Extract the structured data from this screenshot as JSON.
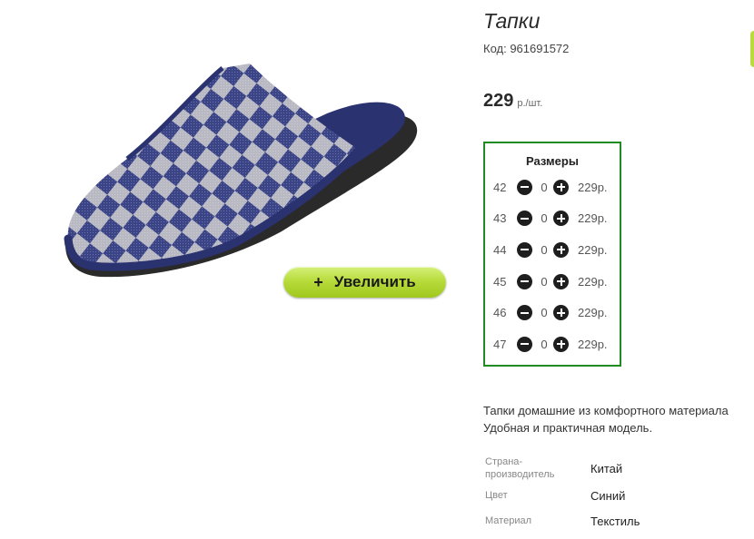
{
  "product": {
    "title": "Тапки",
    "code": "Код: 961691572",
    "price_value": "229",
    "price_unit": "р./шт.",
    "image_icon": "slipper-image",
    "zoom_button": {
      "icon": "plus",
      "label": "Увеличить"
    }
  },
  "sizes": {
    "heading": "Размеры",
    "rows": [
      {
        "size": "42",
        "qty": "0",
        "price": "229р."
      },
      {
        "size": "43",
        "qty": "0",
        "price": "229р."
      },
      {
        "size": "44",
        "qty": "0",
        "price": "229р."
      },
      {
        "size": "45",
        "qty": "0",
        "price": "229р."
      },
      {
        "size": "46",
        "qty": "0",
        "price": "229р."
      },
      {
        "size": "47",
        "qty": "0",
        "price": "229р."
      }
    ]
  },
  "description": {
    "line1": "Тапки домашние из комфортного материала",
    "line2": "Удобная и практичная модель."
  },
  "properties": [
    {
      "label_line1": "Страна-",
      "label_line2": "производитель",
      "value": "Китай"
    },
    {
      "label_line1": "Цвет",
      "label_line2": "",
      "value": "Синий"
    },
    {
      "label_line1": "Материал",
      "label_line2": "",
      "value": "Текстиль"
    }
  ],
  "colors": {
    "accent_green": "#1f8a1f",
    "button_green": "#b8dc3c",
    "slipper_navy": "#2b3270"
  }
}
